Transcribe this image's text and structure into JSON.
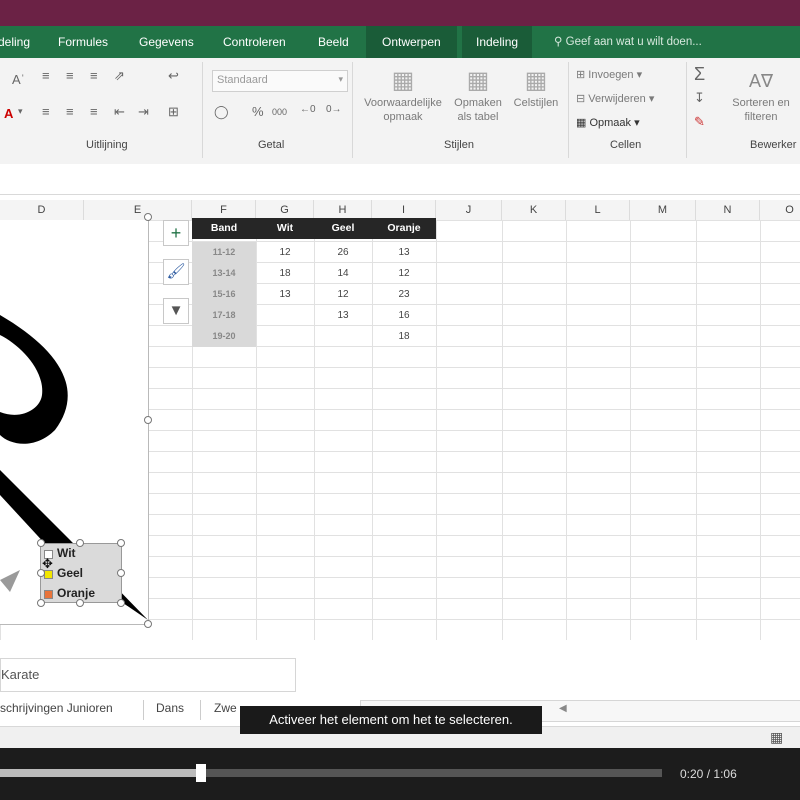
{
  "ribbon_tabs": [
    "deling",
    "Formules",
    "Gegevens",
    "Controleren",
    "Beeld",
    "Ontwerpen",
    "Indeling"
  ],
  "tell_me": "Geef aan wat u wilt doen...",
  "ribbon": {
    "style_select": "Standaard",
    "percent_icon": "%",
    "thousands_icon": "000",
    "conditional_format": [
      "Voorwaardelijke",
      "opmaak"
    ],
    "format_as_table": [
      "Opmaken",
      "als tabel"
    ],
    "cell_styles": "Celstijlen",
    "insert": "Invoegen",
    "delete": "Verwijderen",
    "format": "Opmaak",
    "sort_filter": [
      "Sorteren en",
      "filteren"
    ],
    "groups": {
      "alignment": "Uitlijning",
      "number": "Getal",
      "styles": "Stijlen",
      "cells": "Cellen",
      "editing": "Bewerker"
    }
  },
  "columns": [
    "D",
    "E",
    "F",
    "G",
    "H",
    "I",
    "J",
    "K",
    "L",
    "M",
    "N",
    "O"
  ],
  "table": {
    "headers": [
      "Band",
      "Wit",
      "Geel",
      "Oranje"
    ],
    "rows": [
      [
        "11-12",
        "12",
        "26",
        "13"
      ],
      [
        "13-14",
        "18",
        "14",
        "12"
      ],
      [
        "15-16",
        "13",
        "12",
        "23"
      ],
      [
        "17-18",
        "",
        "13",
        "16"
      ],
      [
        "19-20",
        "",
        "",
        "18"
      ]
    ]
  },
  "chart": {
    "legend": [
      "Wit",
      "Geel",
      "Oranje"
    ],
    "legend_colors": [
      "#ffffff",
      "#f2e600",
      "#e8743b"
    ]
  },
  "chart_buttons": [
    "plus-icon",
    "brush-icon",
    "filter-icon"
  ],
  "name_box_text": "Karate",
  "sheet_tabs": [
    "schrijvingen Junioren",
    "Dans",
    "Zwe"
  ],
  "tooltip": "Activeer het element om het te selecteren.",
  "player": {
    "progress": 0.303,
    "current": "0:20",
    "separator": "/",
    "total": "1:06"
  }
}
